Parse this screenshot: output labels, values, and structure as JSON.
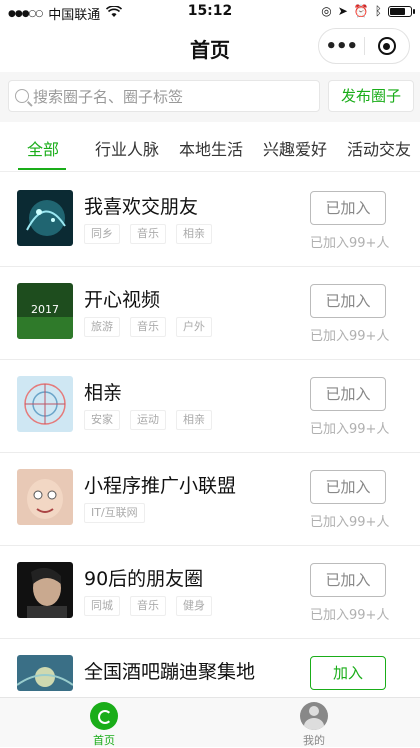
{
  "status_bar": {
    "carrier": "中国联通",
    "time": "15:12"
  },
  "nav": {
    "title": "首页",
    "more_label": "•••"
  },
  "search": {
    "placeholder": "搜索圈子名、圈子标签",
    "publish_label": "发布圈子"
  },
  "tabs": [
    {
      "label": "全部",
      "active": true
    },
    {
      "label": "行业人脉",
      "active": false
    },
    {
      "label": "本地生活",
      "active": false
    },
    {
      "label": "兴趣爱好",
      "active": false
    },
    {
      "label": "活动交友",
      "active": false
    }
  ],
  "circles": [
    {
      "name": "我喜欢交朋友",
      "tags": [
        "同乡",
        "音乐",
        "相亲"
      ],
      "button": "已加入",
      "count": "已加入99+人",
      "thumb_text": ""
    },
    {
      "name": "开心视频",
      "tags": [
        "旅游",
        "音乐",
        "户外"
      ],
      "button": "已加入",
      "count": "已加入99+人",
      "thumb_text": "2017"
    },
    {
      "name": "相亲",
      "tags": [
        "安家",
        "运动",
        "相亲"
      ],
      "button": "已加入",
      "count": "已加入99+人",
      "thumb_text": ""
    },
    {
      "name": "小程序推广小联盟",
      "tags": [
        "IT/互联网"
      ],
      "button": "已加入",
      "count": "已加入99+人",
      "thumb_text": ""
    },
    {
      "name": "90后的朋友圈",
      "tags": [
        "同城",
        "音乐",
        "健身"
      ],
      "button": "已加入",
      "count": "已加入99+人",
      "thumb_text": ""
    },
    {
      "name": "全国酒吧蹦迪聚集地",
      "tags": [],
      "button": "加入",
      "count": "",
      "thumb_text": ""
    }
  ],
  "tabbar": {
    "home_label": "首页",
    "me_label": "我的"
  },
  "colors": {
    "accent": "#1aad19"
  }
}
